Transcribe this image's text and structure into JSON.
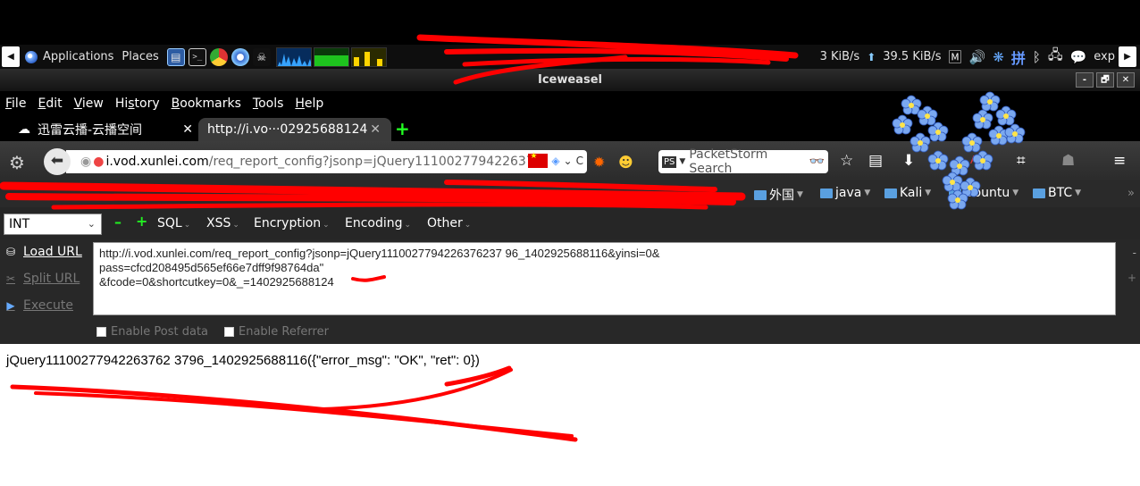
{
  "panel": {
    "menus": [
      "Applications",
      "Places"
    ],
    "net_speed_down": "3 KiB/s",
    "net_speed_up": "39.5 KiB/s",
    "input_method": "拼",
    "user_short": "exp",
    "icons": [
      "debian-icon",
      "file-manager-icon",
      "terminal-icon",
      "chrome-icon",
      "iceweasel-icon",
      "hacker-icon",
      "volume-icon",
      "bluetooth-icon",
      "network-icon",
      "chat-icon"
    ]
  },
  "window": {
    "title": "Iceweasel",
    "buttons": [
      "-",
      "🗗",
      "✕"
    ]
  },
  "menubar": {
    "items": [
      {
        "accel": "F",
        "rest": "ile"
      },
      {
        "accel": "E",
        "rest": "dit"
      },
      {
        "accel": "V",
        "rest": "iew"
      },
      {
        "pre": "Hi",
        "accel": "s",
        "rest": "tory"
      },
      {
        "accel": "B",
        "rest": "ookmarks"
      },
      {
        "accel": "T",
        "rest": "ools"
      },
      {
        "accel": "H",
        "rest": "elp"
      }
    ]
  },
  "tabs": [
    {
      "title": "迅雷云播-云播空间",
      "active": false
    },
    {
      "title": "http://i.vo···02925688124",
      "active": true
    }
  ],
  "navbar": {
    "url_host": "i.vod.xunlei.com",
    "url_path": "/req_report_config?jsonp=jQuery1110027794226376",
    "search_placeholder": "PacketStorm Search"
  },
  "bookmarks": [
    {
      "label": "外国"
    },
    {
      "label": "java"
    },
    {
      "label": "Kali"
    },
    {
      "label": "Ubuntu"
    },
    {
      "label": "BTC"
    }
  ],
  "hackbar": {
    "select_value": "INT",
    "menus": [
      "SQL",
      "XSS",
      "Encryption",
      "Encoding",
      "Other"
    ],
    "actions": {
      "load": "Load URL",
      "split": "Split URL",
      "execute": "Execute"
    },
    "url_lines": [
      "http://i.vod.xunlei.com/req_report_config?jsonp=jQuery1110027794226376237 96_1402925688116&yinsi=0&",
      "pass=cfcd208495d565ef66e7dff9f98764da\"",
      "&fcode=0&shortcutkey=0&_=1402925688124"
    ],
    "checkboxes": [
      "Enable Post data",
      "Enable Referrer"
    ]
  },
  "content": {
    "response": "jQuery11100277942263762 3796_1402925688116({\"error_msg\": \"OK\", \"ret\": 0})"
  },
  "colors": {
    "scribble": "#ff0000",
    "accent_green": "#22dd22"
  }
}
